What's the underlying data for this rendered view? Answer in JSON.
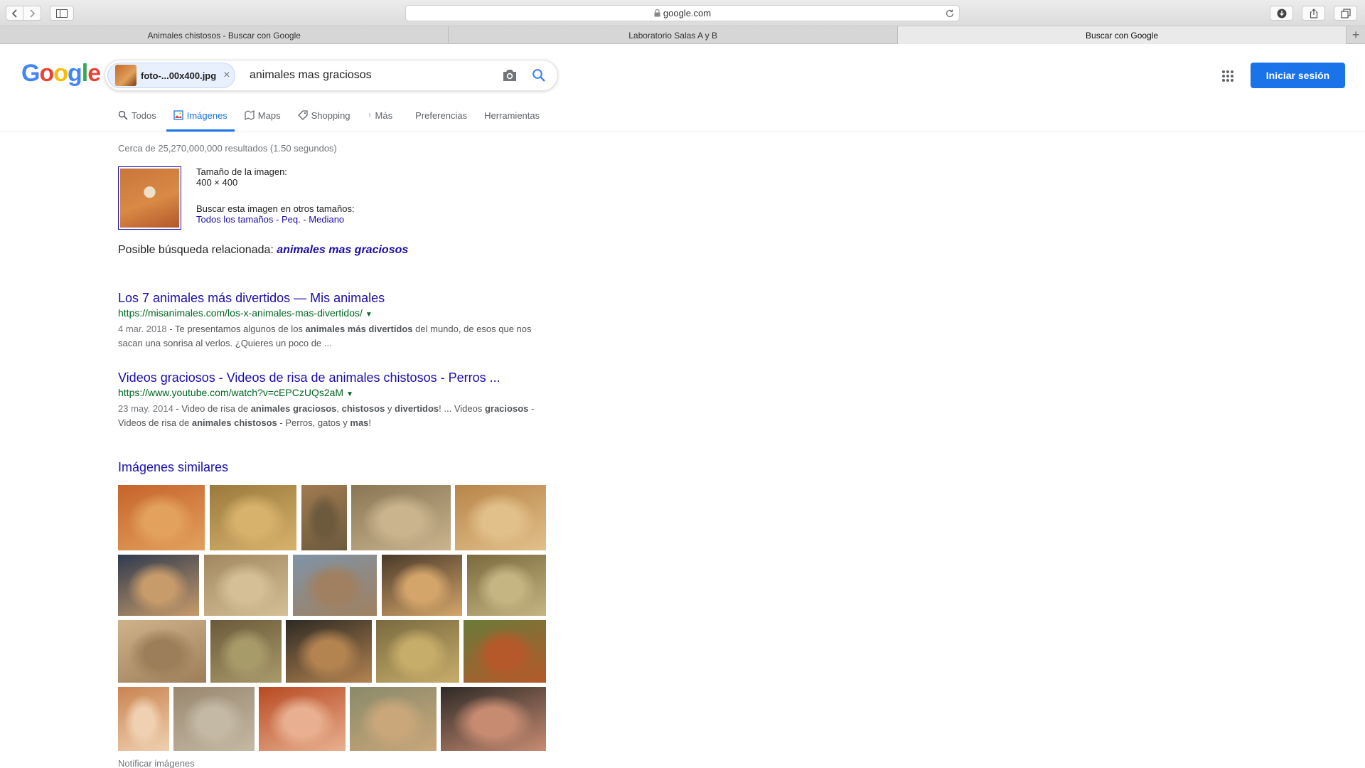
{
  "browser": {
    "url": "google.com",
    "tabs": [
      {
        "label": "Animales chistosos - Buscar con Google"
      },
      {
        "label": "Laboratorio Salas A y B"
      },
      {
        "label": "Buscar con Google"
      }
    ],
    "new_tab_label": "+"
  },
  "header": {
    "logo": [
      "G",
      "o",
      "o",
      "g",
      "l",
      "e"
    ],
    "logo_colors": [
      "#4285F4",
      "#EA4335",
      "#FBBC05",
      "#4285F4",
      "#34A853",
      "#EA4335"
    ],
    "chip_filename": "foto-...00x400.jpg",
    "chip_close": "×",
    "query": "animales mas graciosos",
    "signin_label": "Iniciar sesión"
  },
  "nav": {
    "todos": "Todos",
    "imagenes": "Imágenes",
    "maps": "Maps",
    "shopping": "Shopping",
    "mas": "Más",
    "preferencias": "Preferencias",
    "herramientas": "Herramientas"
  },
  "stats": "Cerca de 25,270,000,000 resultados (1.50 segundos)",
  "image_info": {
    "size_label": "Tamaño de la imagen:",
    "size_value": "400 × 400",
    "other_sizes_label": "Buscar esta imagen en otros tamaños:",
    "size_links": [
      "Todos los tamaños",
      "Peq.",
      "Mediano"
    ],
    "separator": " - "
  },
  "related": {
    "label": "Posible búsqueda relacionada:",
    "query": "animales mas graciosos"
  },
  "results": [
    {
      "title": "Los 7 animales más divertidos — Mis animales",
      "url": "https://misanimales.com/los-x-animales-mas-divertidos/",
      "date": "4 mar. 2018",
      "snippet_parts": [
        {
          "t": " - Te presentamos algunos de los ",
          "b": false
        },
        {
          "t": "animales más divertidos",
          "b": true
        },
        {
          "t": " del mundo, de esos que nos sacan una sonrisa al verlos. ¿Quieres un poco de ...",
          "b": false
        }
      ]
    },
    {
      "title": "Videos graciosos - Videos de risa de animales chistosos - Perros ...",
      "url": "https://www.youtube.com/watch?v=cEPCzUQs2aM",
      "date": "23 may. 2014",
      "snippet_parts": [
        {
          "t": " - Video de risa de ",
          "b": false
        },
        {
          "t": "animales graciosos",
          "b": true
        },
        {
          "t": ", ",
          "b": false
        },
        {
          "t": "chistosos",
          "b": true
        },
        {
          "t": " y ",
          "b": false
        },
        {
          "t": "divertidos",
          "b": true
        },
        {
          "t": "! ... Videos ",
          "b": false
        },
        {
          "t": "graciosos",
          "b": true
        },
        {
          "t": " - Videos de risa de ",
          "b": false
        },
        {
          "t": "animales chistosos",
          "b": true
        },
        {
          "t": " - Perros, gatos y ",
          "b": false
        },
        {
          "t": "mas",
          "b": true
        },
        {
          "t": "!",
          "b": false
        }
      ]
    }
  ],
  "similar": {
    "heading": "Imágenes similares",
    "tiles": [
      {
        "subject": "meerkat dancing",
        "colors": [
          "#c6642b",
          "#e3a15e"
        ]
      },
      {
        "subject": "bird of prey",
        "colors": [
          "#9a7a3c",
          "#d7b26c"
        ]
      },
      {
        "subject": "meerkat on road",
        "colors": [
          "#a07a50",
          "#6d5a3d"
        ]
      },
      {
        "subject": "owls",
        "colors": [
          "#8a7654",
          "#c9b48e"
        ]
      },
      {
        "subject": "lions",
        "colors": [
          "#b8854a",
          "#e2c08a"
        ]
      },
      {
        "subject": "meerkat standing",
        "colors": [
          "#2f3a4e",
          "#c79b6a"
        ]
      },
      {
        "subject": "dust animal",
        "colors": [
          "#a2885f",
          "#d4bf96"
        ]
      },
      {
        "subject": "hippo",
        "colors": [
          "#7f93a6",
          "#a08060"
        ]
      },
      {
        "subject": "meerkat closeup",
        "colors": [
          "#4a3a2a",
          "#d4a56a"
        ]
      },
      {
        "subject": "marmot",
        "colors": [
          "#7b6a3c",
          "#c5b583"
        ]
      },
      {
        "subject": "chipmunk",
        "colors": [
          "#d0b28a",
          "#9c7e5a"
        ]
      },
      {
        "subject": "buffalo",
        "colors": [
          "#6b5a3a",
          "#a89b6a"
        ]
      },
      {
        "subject": "chipmunk cheeks",
        "colors": [
          "#2e2a24",
          "#b38350"
        ]
      },
      {
        "subject": "owl flying",
        "colors": [
          "#7a6a40",
          "#c7ad6a"
        ]
      },
      {
        "subject": "squirrel",
        "colors": [
          "#6a7a3a",
          "#b5592a"
        ]
      },
      {
        "subject": "lamb",
        "colors": [
          "#c98450",
          "#efd0b0"
        ]
      },
      {
        "subject": "kangaroo",
        "colors": [
          "#9a8870",
          "#c4b9a4"
        ]
      },
      {
        "subject": "red panda",
        "colors": [
          "#b84a22",
          "#e8b090"
        ]
      },
      {
        "subject": "giraffe",
        "colors": [
          "#8a8a6a",
          "#c9a77a"
        ]
      },
      {
        "subject": "aardvark",
        "colors": [
          "#2e2a26",
          "#c78b72"
        ]
      }
    ]
  },
  "notify_label": "Notificar imágenes"
}
